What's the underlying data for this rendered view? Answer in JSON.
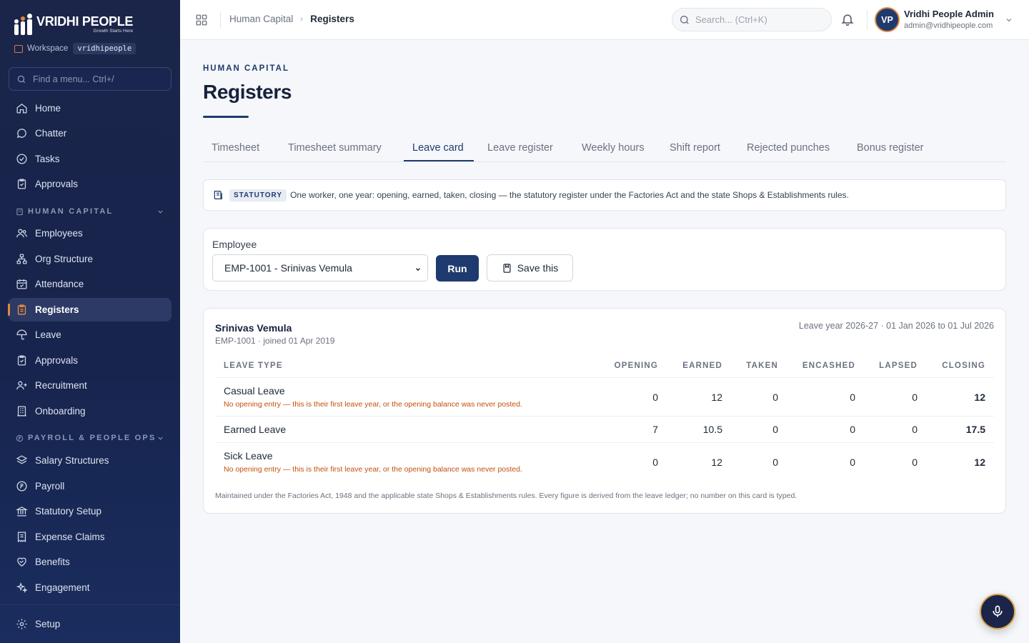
{
  "brand": {
    "name": "VRIDHI PEOPLE",
    "tagline": "Growth Starts Here"
  },
  "workspace": {
    "label": "Workspace",
    "value": "vridhipeople"
  },
  "sidebar": {
    "search_placeholder": "Find a menu... Ctrl+/",
    "top_items": [
      {
        "label": "Home",
        "icon": "home-icon"
      },
      {
        "label": "Chatter",
        "icon": "chat-icon"
      },
      {
        "label": "Tasks",
        "icon": "check-circle-icon"
      },
      {
        "label": "Approvals",
        "icon": "clipboard-check-icon"
      }
    ],
    "section_human_capital": "HUMAN CAPITAL",
    "human_capital_items": [
      {
        "label": "Employees",
        "icon": "users-icon"
      },
      {
        "label": "Org Structure",
        "icon": "org-chart-icon"
      },
      {
        "label": "Attendance",
        "icon": "calendar-check-icon"
      },
      {
        "label": "Registers",
        "icon": "clipboard-list-icon",
        "active": true
      },
      {
        "label": "Leave",
        "icon": "umbrella-icon"
      },
      {
        "label": "Approvals",
        "icon": "clipboard-check-icon"
      },
      {
        "label": "Recruitment",
        "icon": "user-plus-icon"
      },
      {
        "label": "Onboarding",
        "icon": "building-icon"
      }
    ],
    "section_payroll": "PAYROLL & PEOPLE OPS",
    "payroll_items": [
      {
        "label": "Salary Structures",
        "icon": "layers-icon"
      },
      {
        "label": "Payroll",
        "icon": "currency-icon"
      },
      {
        "label": "Statutory Setup",
        "icon": "landmark-icon"
      },
      {
        "label": "Expense Claims",
        "icon": "receipt-icon"
      },
      {
        "label": "Benefits",
        "icon": "heart-handshake-icon"
      },
      {
        "label": "Engagement",
        "icon": "sparkles-icon"
      }
    ],
    "setup": {
      "label": "Setup",
      "icon": "gear-icon"
    }
  },
  "topbar": {
    "breadcrumb": [
      "Human Capital",
      "Registers"
    ],
    "search_placeholder": "Search... (Ctrl+K)",
    "user": {
      "initials": "VP",
      "name": "Vridhi People Admin",
      "email": "admin@vridhipeople.com"
    }
  },
  "page": {
    "eyebrow": "HUMAN CAPITAL",
    "title": "Registers",
    "tabs": [
      "Timesheet",
      "Timesheet summary",
      "Leave card",
      "Leave register",
      "Weekly hours",
      "Shift report",
      "Rejected punches",
      "Bonus register"
    ],
    "active_tab": "Leave card",
    "notice": {
      "badge": "STATUTORY",
      "text": "One worker, one year: opening, earned, taken, closing — the statutory register under the Factories Act and the state Shops & Establishments rules."
    },
    "filter": {
      "employee_label": "Employee",
      "employee_selected": "EMP-1001 - Srinivas Vemula",
      "run_label": "Run",
      "save_label": "Save this"
    },
    "card": {
      "employee_name": "Srinivas Vemula",
      "employee_meta": "EMP-1001 · joined 01 Apr 2019",
      "leave_year": "Leave year 2026-27 · 01 Jan 2026 to 01 Jul 2026",
      "columns": [
        "LEAVE TYPE",
        "OPENING",
        "EARNED",
        "TAKEN",
        "ENCASHED",
        "LAPSED",
        "CLOSING"
      ],
      "rows": [
        {
          "type": "Casual Leave",
          "note": "No opening entry — this is their first leave year, or the opening balance was never posted.",
          "opening": "0",
          "earned": "12",
          "taken": "0",
          "encashed": "0",
          "lapsed": "0",
          "closing": "12"
        },
        {
          "type": "Earned Leave",
          "note": "",
          "opening": "7",
          "earned": "10.5",
          "taken": "0",
          "encashed": "0",
          "lapsed": "0",
          "closing": "17.5"
        },
        {
          "type": "Sick Leave",
          "note": "No opening entry — this is their first leave year, or the opening balance was never posted.",
          "opening": "0",
          "earned": "12",
          "taken": "0",
          "encashed": "0",
          "lapsed": "0",
          "closing": "12"
        }
      ],
      "footnote": "Maintained under the Factories Act, 1948 and the applicable state Shops & Establishments rules. Every figure is derived from the leave ledger; no number on this card is typed."
    }
  },
  "colors": {
    "sidebar_bg": "#1a2549",
    "accent": "#1e3a6e",
    "active_marker": "#e0893f",
    "warning_text": "#c2510c"
  }
}
